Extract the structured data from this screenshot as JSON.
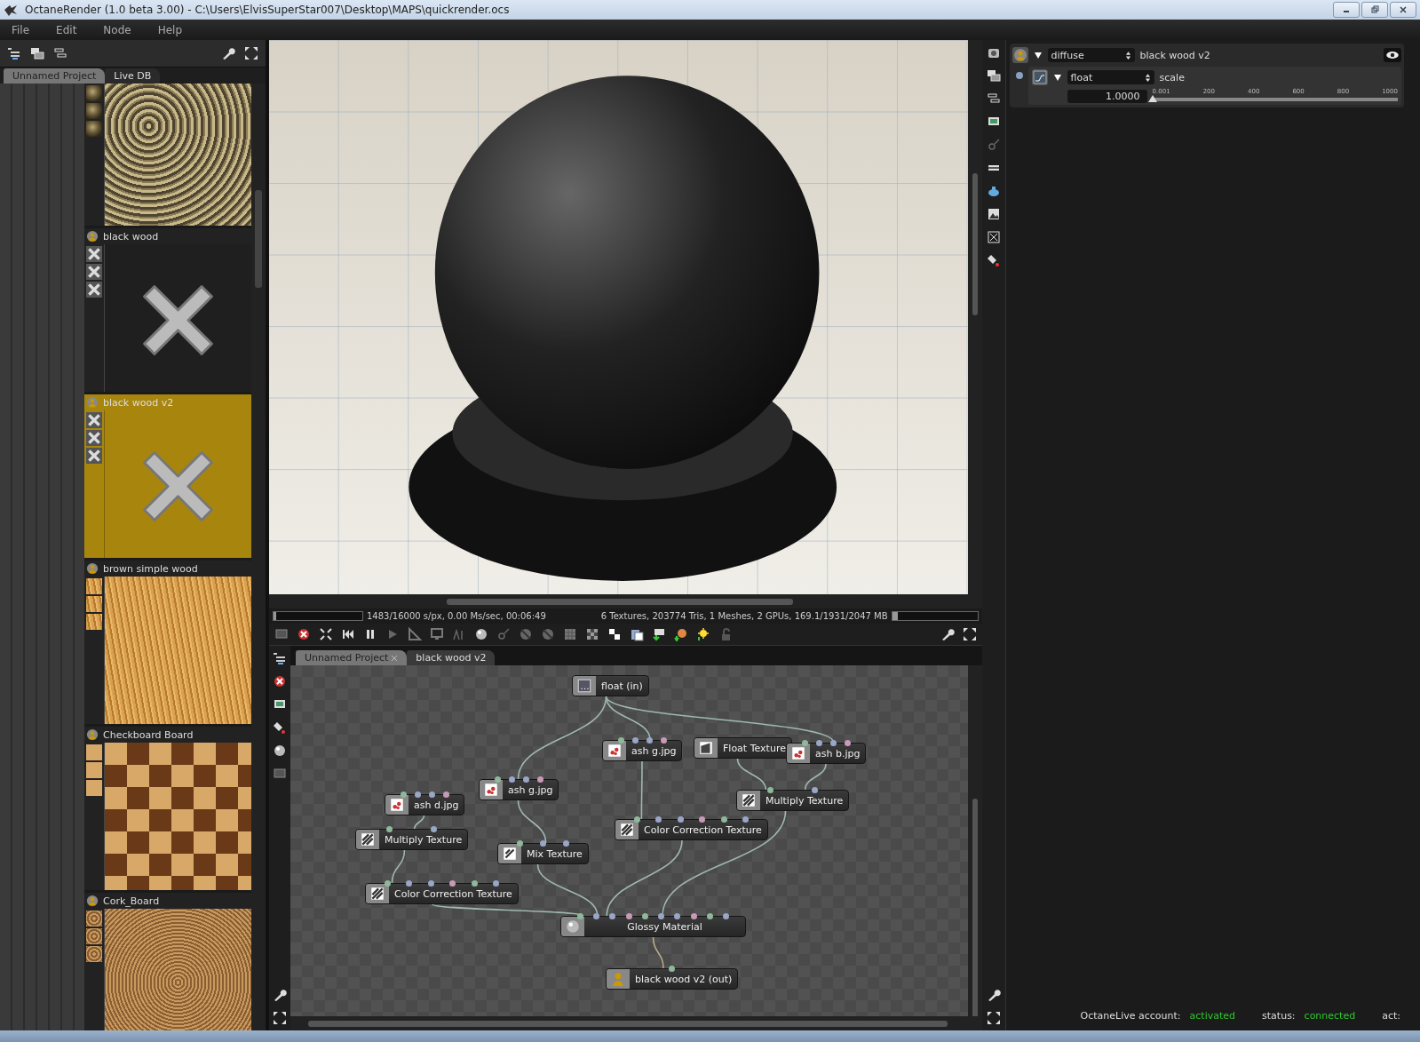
{
  "window": {
    "title": "OctaneRender (1.0 beta 3.00) - C:\\Users\\ElvisSuperStar007\\Desktop\\MAPS\\quickrender.ocs"
  },
  "menu": [
    "File",
    "Edit",
    "Node",
    "Help"
  ],
  "library": {
    "tabs": [
      {
        "label": "Unnamed Project",
        "selected": false
      },
      {
        "label": "Live DB",
        "selected": true
      }
    ],
    "materials": [
      {
        "kind": "bark",
        "selected": false
      },
      {
        "name": "black wood",
        "kind": "missing",
        "selected": false
      },
      {
        "name": "black wood v2",
        "kind": "missing",
        "selected": true
      },
      {
        "name": "brown simple wood",
        "kind": "stripes",
        "selected": false
      },
      {
        "name": "Checkboard Board",
        "kind": "checker",
        "selected": false
      },
      {
        "name": "Cork_Board",
        "kind": "cork",
        "selected": false
      }
    ]
  },
  "render": {
    "progress": {
      "level": 0.03
    },
    "stats_left": "1483/16000 s/px, 0.00 Ms/sec, 00:06:49",
    "stats_right": "6 Textures, 203774 Tris, 1 Meshes, 2 GPUs, 169.1/1931/2047 MB",
    "memory": {
      "level": 0.07
    }
  },
  "node_editor": {
    "tabs": [
      {
        "label": "Unnamed Project",
        "selected": false
      },
      {
        "label": "black wood v2",
        "selected": true
      }
    ],
    "nodes": [
      {
        "label": "float (in)",
        "kind": "input"
      },
      {
        "label": "ash g.jpg",
        "kind": "image"
      },
      {
        "label": "Float Texture",
        "kind": "float"
      },
      {
        "label": "ash b.jpg",
        "kind": "image"
      },
      {
        "label": "ash g.jpg",
        "kind": "image"
      },
      {
        "label": "ash d.jpg",
        "kind": "image"
      },
      {
        "label": "Multiply Texture",
        "kind": "multiply"
      },
      {
        "label": "Color Correction Texture",
        "kind": "correction"
      },
      {
        "label": "Multiply Texture",
        "kind": "multiply"
      },
      {
        "label": "Mix Texture",
        "kind": "mix"
      },
      {
        "label": "Color Correction Texture",
        "kind": "correction"
      },
      {
        "label": "Glossy Material",
        "kind": "material"
      },
      {
        "label": "black wood v2 (out)",
        "kind": "output"
      }
    ]
  },
  "inspector": {
    "pin": "diffuse",
    "expanded": true,
    "name": "black wood v2",
    "param": {
      "type": "float",
      "expanded": true,
      "name": "scale",
      "value": "1.0000",
      "slider": {
        "level": 0.001,
        "ticks": [
          "0.001",
          "200",
          "400",
          "600",
          "800",
          "1000"
        ]
      }
    }
  },
  "status": {
    "account_label": "OctaneLive account:",
    "account": "activated",
    "status_label": "status:",
    "status": "connected",
    "act_label": "act:"
  }
}
